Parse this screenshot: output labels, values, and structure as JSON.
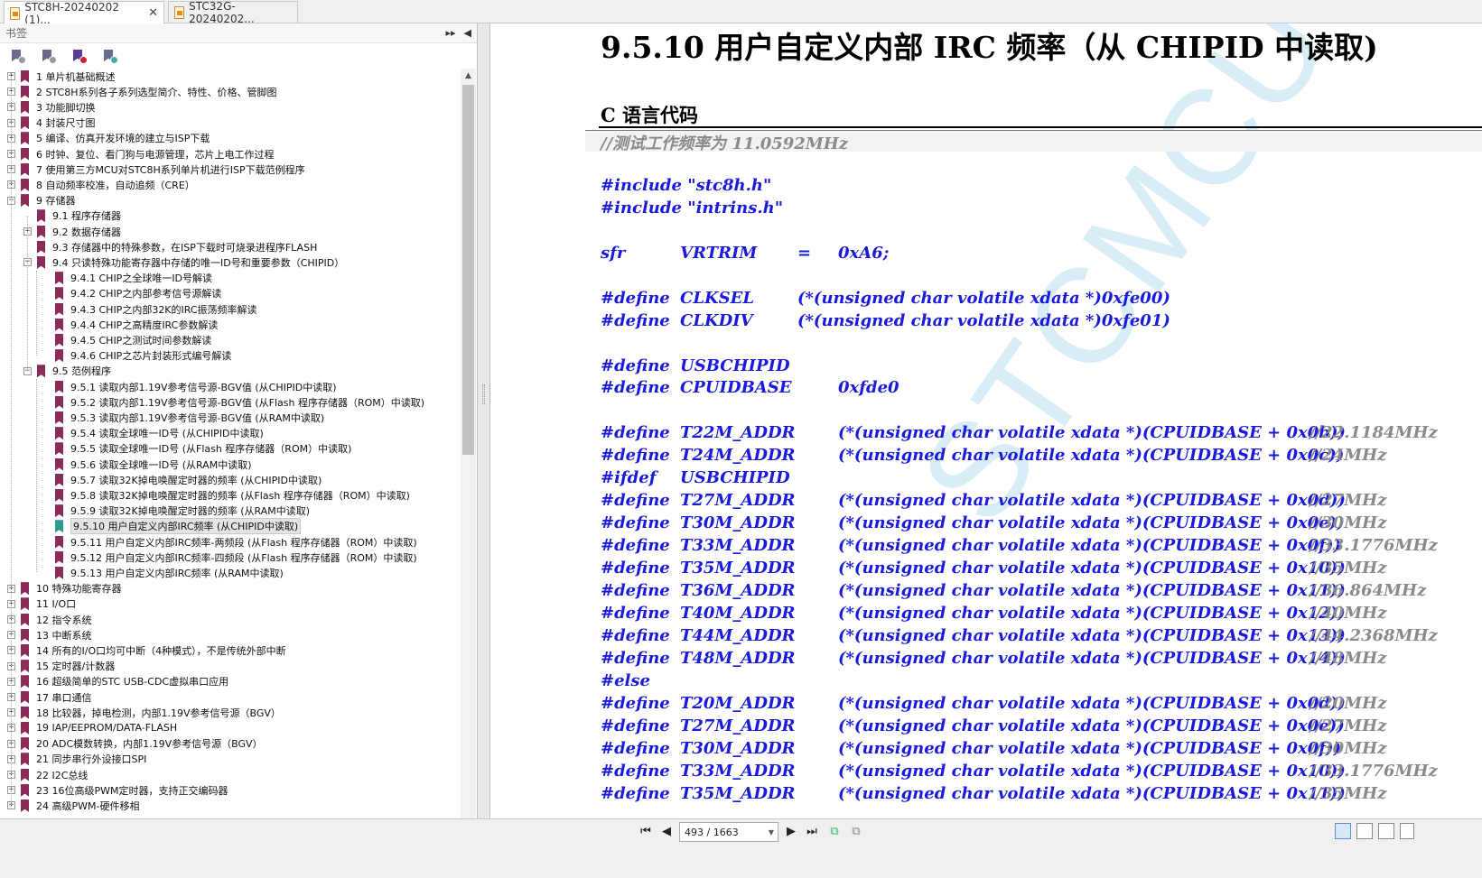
{
  "tabs": [
    {
      "label": "STC8H-20240202 (1)...",
      "active": true
    },
    {
      "label": "STC32G-20240202...",
      "active": false
    }
  ],
  "panel": {
    "title": "书签"
  },
  "bookmarks": [
    {
      "label": "1 单片机基础概述",
      "level": 0,
      "expand": "+"
    },
    {
      "label": "2  STC8H系列各子系列选型简介、特性、价格、管脚图",
      "level": 0,
      "expand": "+"
    },
    {
      "label": "3  功能脚切换",
      "level": 0,
      "expand": "+"
    },
    {
      "label": "4  封装尺寸图",
      "level": 0,
      "expand": "+"
    },
    {
      "label": "5  编译、仿真开发环境的建立与ISP下载",
      "level": 0,
      "expand": "+"
    },
    {
      "label": "6  时钟、复位、看门狗与电源管理，芯片上电工作过程",
      "level": 0,
      "expand": "+"
    },
    {
      "label": "7  使用第三方MCU对STC8H系列单片机进行ISP下载范例程序",
      "level": 0,
      "expand": "+"
    },
    {
      "label": "8  自动频率校准，自动追频（CRE）",
      "level": 0,
      "expand": "+"
    },
    {
      "label": "9  存储器",
      "level": 0,
      "expand": "-"
    },
    {
      "label": "9.1 程序存储器",
      "level": 1,
      "expand": ""
    },
    {
      "label": "9.2  数据存储器",
      "level": 1,
      "expand": "+"
    },
    {
      "label": "9.3  存储器中的特殊参数，在ISP下载时可烧录进程序FLASH",
      "level": 1,
      "expand": ""
    },
    {
      "label": "9.4  只读特殊功能寄存器中存储的唯一ID号和重要参数（CHIPID）",
      "level": 1,
      "expand": "-"
    },
    {
      "label": "9.4.1  CHIP之全球唯一ID号解读",
      "level": 2,
      "expand": ""
    },
    {
      "label": "9.4.2 CHIP之内部参考信号源解读",
      "level": 2,
      "expand": ""
    },
    {
      "label": "9.4.3 CHIP之内部32K的IRC振荡频率解读",
      "level": 2,
      "expand": ""
    },
    {
      "label": "9.4.4  CHIP之高精度IRC参数解读",
      "level": 2,
      "expand": ""
    },
    {
      "label": "9.4.5  CHIP之测试时间参数解读",
      "level": 2,
      "expand": ""
    },
    {
      "label": "9.4.6 CHIP之芯片封装形式编号解读",
      "level": 2,
      "expand": ""
    },
    {
      "label": "9.5  范例程序",
      "level": 1,
      "expand": "-"
    },
    {
      "label": "9.5.1 读取内部1.19V参考信号源-BGV值 (从CHIPID中读取)",
      "level": 2,
      "expand": ""
    },
    {
      "label": "9.5.2 读取内部1.19V参考信号源-BGV值 (从Flash 程序存储器（ROM）中读取)",
      "level": 2,
      "expand": ""
    },
    {
      "label": "9.5.3 读取内部1.19V参考信号源-BGV值 (从RAM中读取)",
      "level": 2,
      "expand": ""
    },
    {
      "label": "9.5.4 读取全球唯一ID号 (从CHIPID中读取)",
      "level": 2,
      "expand": ""
    },
    {
      "label": "9.5.5 读取全球唯一ID号 (从Flash 程序存储器（ROM）中读取)",
      "level": 2,
      "expand": ""
    },
    {
      "label": "9.5.6 读取全球唯一ID号 (从RAM中读取)",
      "level": 2,
      "expand": ""
    },
    {
      "label": "9.5.7 读取32K掉电唤醒定时器的频率 (从CHIPID中读取)",
      "level": 2,
      "expand": ""
    },
    {
      "label": "9.5.8 读取32K掉电唤醒定时器的频率 (从Flash 程序存储器（ROM）中读取)",
      "level": 2,
      "expand": ""
    },
    {
      "label": "9.5.9 读取32K掉电唤醒定时器的频率 (从RAM中读取)",
      "level": 2,
      "expand": ""
    },
    {
      "label": "9.5.10 用户自定义内部IRC频率 (从CHIPID中读取)",
      "level": 2,
      "expand": "",
      "selected": true
    },
    {
      "label": "9.5.11 用户自定义内部IRC频率-两频段 (从Flash 程序存储器（ROM）中读取)",
      "level": 2,
      "expand": ""
    },
    {
      "label": "9.5.12 用户自定义内部IRC频率-四频段 (从Flash 程序存储器（ROM）中读取)",
      "level": 2,
      "expand": ""
    },
    {
      "label": "9.5.13 用户自定义内部IRC频率 (从RAM中读取)",
      "level": 2,
      "expand": ""
    },
    {
      "label": "10  特殊功能寄存器",
      "level": 0,
      "expand": "+"
    },
    {
      "label": "11  I/O口",
      "level": 0,
      "expand": "+"
    },
    {
      "label": "12  指令系统",
      "level": 0,
      "expand": "+"
    },
    {
      "label": "13  中断系统",
      "level": 0,
      "expand": "+"
    },
    {
      "label": "14  所有的I/O口均可中断（4种模式），不是传统外部中断",
      "level": 0,
      "expand": "+"
    },
    {
      "label": "15  定时器/计数器",
      "level": 0,
      "expand": "+"
    },
    {
      "label": "16  超级简单的STC USB-CDC虚拟串口应用",
      "level": 0,
      "expand": "+"
    },
    {
      "label": "17  串口通信",
      "level": 0,
      "expand": "+"
    },
    {
      "label": "18  比较器，掉电检测，内部1.19V参考信号源（BGV）",
      "level": 0,
      "expand": "+"
    },
    {
      "label": "19  IAP/EEPROM/DATA-FLASH",
      "level": 0,
      "expand": "+"
    },
    {
      "label": "20  ADC模数转换，内部1.19V参考信号源（BGV）",
      "level": 0,
      "expand": "+"
    },
    {
      "label": "21  同步串行外设接口SPI",
      "level": 0,
      "expand": "+"
    },
    {
      "label": "22  I2C总线",
      "level": 0,
      "expand": "+"
    },
    {
      "label": "23  16位高级PWM定时器，支持正交编码器",
      "level": 0,
      "expand": "+"
    },
    {
      "label": "24  高级PWM-硬件移相",
      "level": 0,
      "expand": "+"
    }
  ],
  "doc": {
    "section_title": "9.5.10  用户自定义内部 IRC 频率（从 CHIPID 中读取)",
    "subheading": "C 语言代码",
    "watermark": "STCMCU",
    "code_lines": [
      {
        "c1": "//测试工作频率为 11.0592MHz",
        "cmt": true
      },
      {
        "c1": ""
      },
      {
        "c1": "#include \"stc8h.h\""
      },
      {
        "c1": "#include \"intrins.h\""
      },
      {
        "c1": ""
      },
      {
        "c1": "sfr",
        "c2": "VRTRIM",
        "c3": "=",
        "c3b": "0xA6;"
      },
      {
        "c1": ""
      },
      {
        "c1": "#define",
        "c2": "CLKSEL",
        "c3": "(*(unsigned char volatile xdata *)0xfe00)"
      },
      {
        "c1": "#define",
        "c2": "CLKDIV",
        "c3": "(*(unsigned char volatile xdata *)0xfe01)"
      },
      {
        "c1": ""
      },
      {
        "c1": "#define",
        "c2": "USBCHIPID"
      },
      {
        "c1": "#define",
        "c2": "CPUIDBASE",
        "c3b": "0xfde0"
      },
      {
        "c1": ""
      },
      {
        "c1": "#define",
        "c2": "T22M_ADDR",
        "c3b": "(*(unsigned char volatile xdata *)(CPUIDBASE + 0x0b))",
        "c4": "//22.1184MHz"
      },
      {
        "c1": "#define",
        "c2": "T24M_ADDR",
        "c3b": "(*(unsigned char volatile xdata *)(CPUIDBASE + 0x0c))",
        "c4": "//24MHz"
      },
      {
        "c1": "#ifdef",
        "c2": "USBCHIPID"
      },
      {
        "c1": "#define",
        "c2": "T27M_ADDR",
        "c3b": "(*(unsigned char volatile xdata *)(CPUIDBASE + 0x0d))",
        "c4": "//27MHz"
      },
      {
        "c1": "#define",
        "c2": "T30M_ADDR",
        "c3b": "(*(unsigned char volatile xdata *)(CPUIDBASE + 0x0e))",
        "c4": "//30MHz"
      },
      {
        "c1": "#define",
        "c2": "T33M_ADDR",
        "c3b": "(*(unsigned char volatile xdata *)(CPUIDBASE + 0x0f))",
        "c4": "//33.1776MHz"
      },
      {
        "c1": "#define",
        "c2": "T35M_ADDR",
        "c3b": "(*(unsigned char volatile xdata *)(CPUIDBASE + 0x10))",
        "c4": "//35MHz"
      },
      {
        "c1": "#define",
        "c2": "T36M_ADDR",
        "c3b": "(*(unsigned char volatile xdata *)(CPUIDBASE + 0x11))",
        "c4": "//36.864MHz"
      },
      {
        "c1": "#define",
        "c2": "T40M_ADDR",
        "c3b": "(*(unsigned char volatile xdata *)(CPUIDBASE + 0x12))",
        "c4": "//40MHz"
      },
      {
        "c1": "#define",
        "c2": "T44M_ADDR",
        "c3b": "(*(unsigned char volatile xdata *)(CPUIDBASE + 0x13))",
        "c4": "//44.2368MHz"
      },
      {
        "c1": "#define",
        "c2": "T48M_ADDR",
        "c3b": "(*(unsigned char volatile xdata *)(CPUIDBASE + 0x14))",
        "c4": "//48MHz"
      },
      {
        "c1": "#else"
      },
      {
        "c1": "#define",
        "c2": "T20M_ADDR",
        "c3b": "(*(unsigned char volatile xdata *)(CPUIDBASE + 0x0d))",
        "c4": "//20MHz"
      },
      {
        "c1": "#define",
        "c2": "T27M_ADDR",
        "c3b": "(*(unsigned char volatile xdata *)(CPUIDBASE + 0x0e))",
        "c4": "//27MHz"
      },
      {
        "c1": "#define",
        "c2": "T30M_ADDR",
        "c3b": "(*(unsigned char volatile xdata *)(CPUIDBASE + 0x0f))",
        "c4": "//30MHz"
      },
      {
        "c1": "#define",
        "c2": "T33M_ADDR",
        "c3b": "(*(unsigned char volatile xdata *)(CPUIDBASE + 0x10))",
        "c4": "//33.1776MHz"
      },
      {
        "c1": "#define",
        "c2": "T35M_ADDR",
        "c3b": "(*(unsigned char volatile xdata *)(CPUIDBASE + 0x11))",
        "c4": "//35MHz"
      }
    ]
  },
  "nav": {
    "page_display": "493 / 1663"
  },
  "colors": {
    "bookmark": "#8a2b5a",
    "bookmark_selected": "#2f9b8c",
    "code": "#1a1adc"
  }
}
